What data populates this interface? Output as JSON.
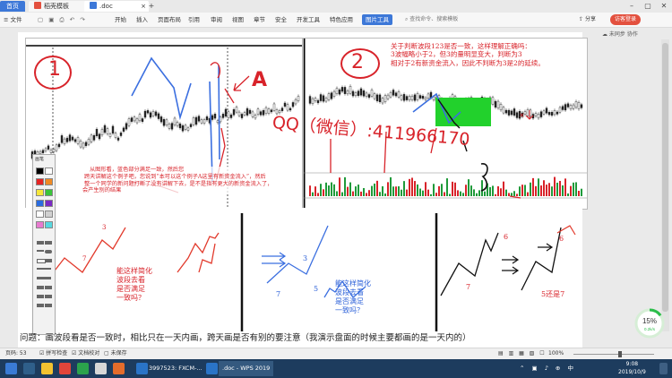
{
  "tabs": [
    {
      "label": "首页"
    },
    {
      "label": "稻壳模板"
    },
    {
      "label": ".doc"
    }
  ],
  "menu": {
    "file": "文件",
    "items": [
      "开始",
      "插入",
      "页面布局",
      "引用",
      "审阅",
      "视图",
      "章节",
      "安全",
      "开发工具",
      "特色应用",
      "图片工具"
    ],
    "search_placeholder": "查找命令、搜索模板",
    "login": "访客登录",
    "share": "分享",
    "sync": "未同步",
    "collab": "协作"
  },
  "annotations": {
    "label1": "1",
    "label2": "2",
    "labelA": "A",
    "qq": "QQ（微信）:411966170",
    "note_lines": [
      "关于判断波段123是否一致，这样理解正确吗：",
      "3波幅略小于2，但3的量明显变大，判断为3",
      "相对于2有新资金流入，因此不判断为3是2的延续。"
    ],
    "reply_lines": [
      "从图形看，蓝色部分满足一致，然后您",
      "跨天讲解这个例子吧，您说到“本可以这个例子A这里有新资金流入”，然后",
      "整一个同学的新问题打断了没有讲解下去，是不是指有更大的新资金流入了，",
      "会产生别的结果"
    ],
    "q_left": [
      "能这样简化",
      "波段去看",
      "是否满足",
      "一致吗？"
    ],
    "q_mid": [
      "能这样简化",
      "波段去看",
      "是否满足",
      "一致吗？"
    ],
    "wave_nums": [
      "3",
      "5",
      "7",
      "3",
      "5",
      "7",
      "6",
      "7",
      "6",
      "5还是7"
    ]
  },
  "bottom_text": "问题：画波段看是否一致时，相比只在一天内画，跨天画是否有别的要注意（我演示盘面的时候主要都画的是一天内的）",
  "palette": {
    "title": "画笔",
    "colors": [
      "#000000",
      "#ffffff",
      "#e62424",
      "#f08a24",
      "#f5e63a",
      "#3ac43a",
      "#2a6ce0",
      "#7a2ac4",
      "#ffffff",
      "#d0d0d0",
      "#e87ad0",
      "#58d8e0"
    ]
  },
  "status": {
    "page": "页码: 53",
    "spell": "拼写检查",
    "doc_check": "文档校对",
    "saved": "未保存",
    "zoom": "100%"
  },
  "progress": {
    "percent": "15%",
    "label": "0.2k/s"
  },
  "taskbar": {
    "item1": "3997523: FXCM-...",
    "item2": ".doc - WPS 2019",
    "time": "9:08",
    "date": "2019/10/9"
  },
  "colors": {
    "accent": "#3d78d8",
    "annotation": "#d8232a",
    "taskbar": "#1d3c5e"
  }
}
